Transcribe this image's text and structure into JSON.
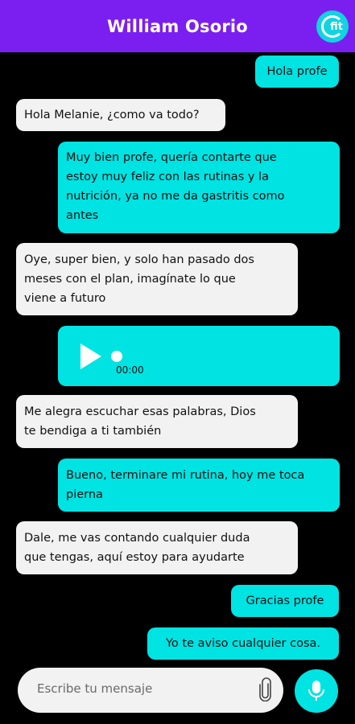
{
  "header": {
    "title": "William Osorio",
    "logo_text": "fit"
  },
  "messages": {
    "m1": "Hola profe",
    "m2": "Hola Melanie, ¿como va todo?",
    "m3_line1": "Muy bien profe, quería contarte que",
    "m3_line2": "estoy muy feliz con las rutinas y la",
    "m3_line3": "nutrición, ya no me da gastritis como",
    "m3_line4": "antes",
    "m4_line1": "Oye, super bien, y solo han pasado dos",
    "m4_line2": "meses con el plan, imagínate lo que",
    "m4_line3": "viene a futuro",
    "audio_time": "00:00",
    "m6_line1": "Me alegra escuchar esas palabras, Dios",
    "m6_line2": "te bendiga a ti también",
    "m7_line1": "Bueno, terminare mi rutina, hoy me toca",
    "m7_line2": "pierna",
    "m8_line1": "Dale, me vas contando cualquier duda",
    "m8_line2": "que tengas, aquí estoy para ayudarte",
    "m9": "Gracias profe",
    "m10": "Yo te aviso cualquier cosa."
  },
  "composer": {
    "placeholder": "Escribe tu mensaje"
  },
  "colors": {
    "header": "#7b1ff0",
    "outgoing": "#00e3e3",
    "incoming": "#f2f2f2",
    "background": "#000000"
  },
  "icons": {
    "attach": "paperclip-icon",
    "send": "microphone-icon",
    "play": "play-icon"
  }
}
